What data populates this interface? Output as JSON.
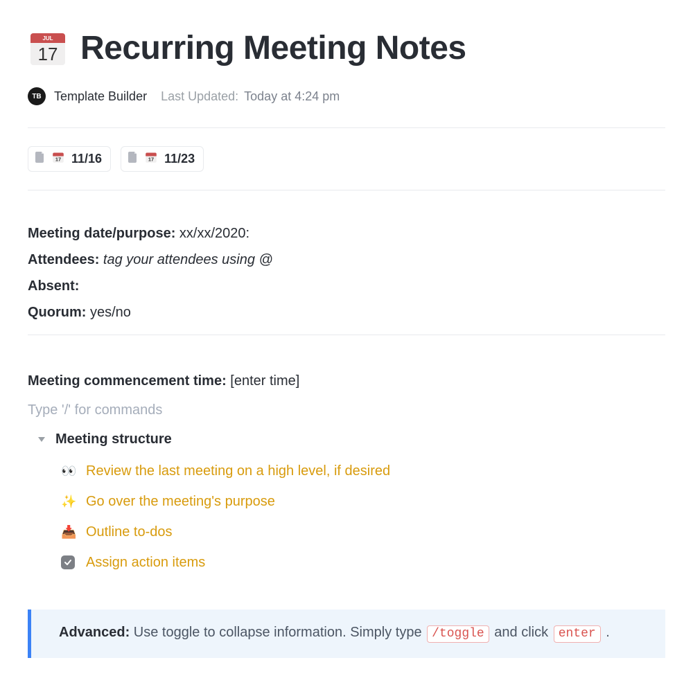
{
  "page": {
    "icon_name": "calendar-icon",
    "title": "Recurring Meeting Notes"
  },
  "meta": {
    "avatar_initials": "TB",
    "author": "Template Builder",
    "updated_label": "Last Updated:",
    "updated_value": "Today at 4:24 pm"
  },
  "subpages": [
    {
      "label": "11/16"
    },
    {
      "label": "11/23"
    }
  ],
  "fields": {
    "date_label": "Meeting date/purpose:",
    "date_value": "xx/xx/2020:",
    "attendees_label": "Attendees:",
    "attendees_value": "tag your attendees using @",
    "absent_label": "Absent:",
    "absent_value": "",
    "quorum_label": "Quorum:",
    "quorum_value": "yes/no"
  },
  "commencement": {
    "label": "Meeting commencement time:",
    "value": "[enter time]"
  },
  "editor_hint": "Type '/' for commands",
  "structure": {
    "heading": "Meeting structure",
    "items": [
      {
        "emoji": "👀",
        "text": "Review the last meeting on a high level, if desired"
      },
      {
        "emoji": "✨",
        "text": "Go over the meeting's purpose"
      },
      {
        "emoji": "📥",
        "text": "Outline to-dos"
      },
      {
        "emoji": "check",
        "text": "Assign action items"
      }
    ]
  },
  "callout": {
    "strong": "Advanced:",
    "text1": " Use toggle to collapse information. Simply type ",
    "kbd1": "/toggle",
    "text2": " and click ",
    "kbd2": "enter",
    "text3": " ."
  }
}
